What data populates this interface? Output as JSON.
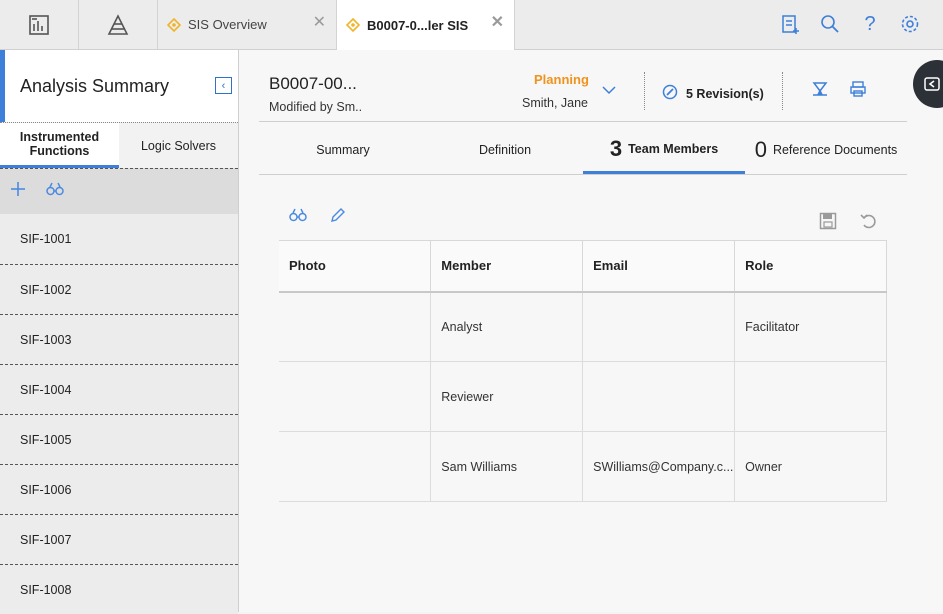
{
  "topbar": {
    "tabs": [
      {
        "label": "SIS Overview",
        "active": false
      },
      {
        "label": "B0007-0...ler SIS",
        "active": true
      }
    ],
    "icons": [
      "dashboard-icon",
      "pyramid-icon",
      "clipboard-add-icon",
      "search-icon",
      "help-icon",
      "settings-icon"
    ],
    "help_glyph": "?"
  },
  "leftpanel": {
    "title": "Analysis Summary",
    "tabs": [
      {
        "label": "Instrumented Functions",
        "active": true
      },
      {
        "label": "Logic Solvers",
        "active": false
      }
    ],
    "items": [
      "SIF-1001",
      "SIF-1002",
      "SIF-1003",
      "SIF-1004",
      "SIF-1005",
      "SIF-1006",
      "SIF-1007",
      "SIF-1008"
    ]
  },
  "record": {
    "id": "B0007-00...",
    "modified_by": "Modified by Sm..",
    "state": "Planning",
    "state_user": "Smith, Jane",
    "revisions": "5 Revision(s)"
  },
  "maintabs": [
    {
      "label": "Summary",
      "count": "",
      "active": false
    },
    {
      "label": "Definition",
      "count": "",
      "active": false
    },
    {
      "label": "Team Members",
      "count": "3",
      "active": true
    },
    {
      "label": "Reference Documents",
      "count": "0",
      "active": false
    }
  ],
  "team_table": {
    "columns": [
      "Photo",
      "Member",
      "Email",
      "Role"
    ],
    "rows": [
      {
        "photo": "",
        "member": "Analyst",
        "email": "",
        "role": "Facilitator"
      },
      {
        "photo": "",
        "member": "Reviewer",
        "email": "",
        "role": ""
      },
      {
        "photo": "",
        "member": "Sam Williams",
        "email": "SWilliams@Company.c...",
        "role": "Owner"
      }
    ]
  },
  "colors": {
    "accent": "#3d7fd9",
    "state": "#f0931c",
    "tab_diamond": "#f0b429"
  }
}
